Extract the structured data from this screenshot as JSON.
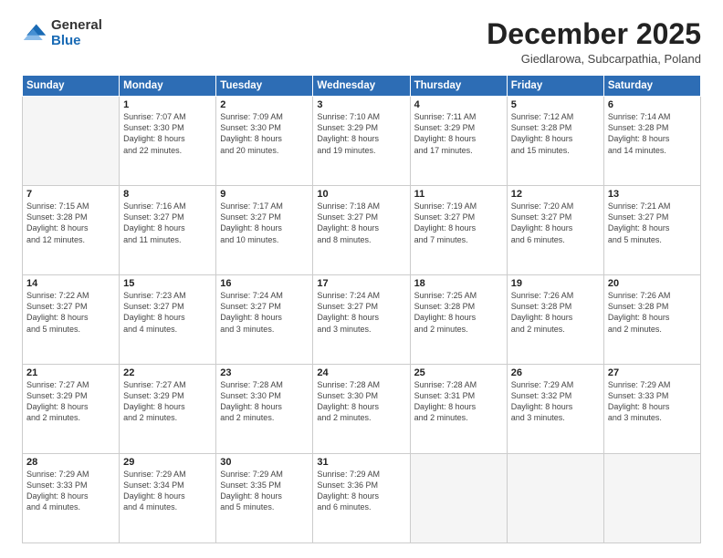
{
  "logo": {
    "general": "General",
    "blue": "Blue"
  },
  "header": {
    "month": "December 2025",
    "location": "Giedlarowa, Subcarpathia, Poland"
  },
  "weekdays": [
    "Sunday",
    "Monday",
    "Tuesday",
    "Wednesday",
    "Thursday",
    "Friday",
    "Saturday"
  ],
  "weeks": [
    [
      {
        "day": "",
        "info": ""
      },
      {
        "day": "1",
        "info": "Sunrise: 7:07 AM\nSunset: 3:30 PM\nDaylight: 8 hours\nand 22 minutes."
      },
      {
        "day": "2",
        "info": "Sunrise: 7:09 AM\nSunset: 3:30 PM\nDaylight: 8 hours\nand 20 minutes."
      },
      {
        "day": "3",
        "info": "Sunrise: 7:10 AM\nSunset: 3:29 PM\nDaylight: 8 hours\nand 19 minutes."
      },
      {
        "day": "4",
        "info": "Sunrise: 7:11 AM\nSunset: 3:29 PM\nDaylight: 8 hours\nand 17 minutes."
      },
      {
        "day": "5",
        "info": "Sunrise: 7:12 AM\nSunset: 3:28 PM\nDaylight: 8 hours\nand 15 minutes."
      },
      {
        "day": "6",
        "info": "Sunrise: 7:14 AM\nSunset: 3:28 PM\nDaylight: 8 hours\nand 14 minutes."
      }
    ],
    [
      {
        "day": "7",
        "info": "Sunrise: 7:15 AM\nSunset: 3:28 PM\nDaylight: 8 hours\nand 12 minutes."
      },
      {
        "day": "8",
        "info": "Sunrise: 7:16 AM\nSunset: 3:27 PM\nDaylight: 8 hours\nand 11 minutes."
      },
      {
        "day": "9",
        "info": "Sunrise: 7:17 AM\nSunset: 3:27 PM\nDaylight: 8 hours\nand 10 minutes."
      },
      {
        "day": "10",
        "info": "Sunrise: 7:18 AM\nSunset: 3:27 PM\nDaylight: 8 hours\nand 8 minutes."
      },
      {
        "day": "11",
        "info": "Sunrise: 7:19 AM\nSunset: 3:27 PM\nDaylight: 8 hours\nand 7 minutes."
      },
      {
        "day": "12",
        "info": "Sunrise: 7:20 AM\nSunset: 3:27 PM\nDaylight: 8 hours\nand 6 minutes."
      },
      {
        "day": "13",
        "info": "Sunrise: 7:21 AM\nSunset: 3:27 PM\nDaylight: 8 hours\nand 5 minutes."
      }
    ],
    [
      {
        "day": "14",
        "info": "Sunrise: 7:22 AM\nSunset: 3:27 PM\nDaylight: 8 hours\nand 5 minutes."
      },
      {
        "day": "15",
        "info": "Sunrise: 7:23 AM\nSunset: 3:27 PM\nDaylight: 8 hours\nand 4 minutes."
      },
      {
        "day": "16",
        "info": "Sunrise: 7:24 AM\nSunset: 3:27 PM\nDaylight: 8 hours\nand 3 minutes."
      },
      {
        "day": "17",
        "info": "Sunrise: 7:24 AM\nSunset: 3:27 PM\nDaylight: 8 hours\nand 3 minutes."
      },
      {
        "day": "18",
        "info": "Sunrise: 7:25 AM\nSunset: 3:28 PM\nDaylight: 8 hours\nand 2 minutes."
      },
      {
        "day": "19",
        "info": "Sunrise: 7:26 AM\nSunset: 3:28 PM\nDaylight: 8 hours\nand 2 minutes."
      },
      {
        "day": "20",
        "info": "Sunrise: 7:26 AM\nSunset: 3:28 PM\nDaylight: 8 hours\nand 2 minutes."
      }
    ],
    [
      {
        "day": "21",
        "info": "Sunrise: 7:27 AM\nSunset: 3:29 PM\nDaylight: 8 hours\nand 2 minutes."
      },
      {
        "day": "22",
        "info": "Sunrise: 7:27 AM\nSunset: 3:29 PM\nDaylight: 8 hours\nand 2 minutes."
      },
      {
        "day": "23",
        "info": "Sunrise: 7:28 AM\nSunset: 3:30 PM\nDaylight: 8 hours\nand 2 minutes."
      },
      {
        "day": "24",
        "info": "Sunrise: 7:28 AM\nSunset: 3:30 PM\nDaylight: 8 hours\nand 2 minutes."
      },
      {
        "day": "25",
        "info": "Sunrise: 7:28 AM\nSunset: 3:31 PM\nDaylight: 8 hours\nand 2 minutes."
      },
      {
        "day": "26",
        "info": "Sunrise: 7:29 AM\nSunset: 3:32 PM\nDaylight: 8 hours\nand 3 minutes."
      },
      {
        "day": "27",
        "info": "Sunrise: 7:29 AM\nSunset: 3:33 PM\nDaylight: 8 hours\nand 3 minutes."
      }
    ],
    [
      {
        "day": "28",
        "info": "Sunrise: 7:29 AM\nSunset: 3:33 PM\nDaylight: 8 hours\nand 4 minutes."
      },
      {
        "day": "29",
        "info": "Sunrise: 7:29 AM\nSunset: 3:34 PM\nDaylight: 8 hours\nand 4 minutes."
      },
      {
        "day": "30",
        "info": "Sunrise: 7:29 AM\nSunset: 3:35 PM\nDaylight: 8 hours\nand 5 minutes."
      },
      {
        "day": "31",
        "info": "Sunrise: 7:29 AM\nSunset: 3:36 PM\nDaylight: 8 hours\nand 6 minutes."
      },
      {
        "day": "",
        "info": ""
      },
      {
        "day": "",
        "info": ""
      },
      {
        "day": "",
        "info": ""
      }
    ]
  ]
}
